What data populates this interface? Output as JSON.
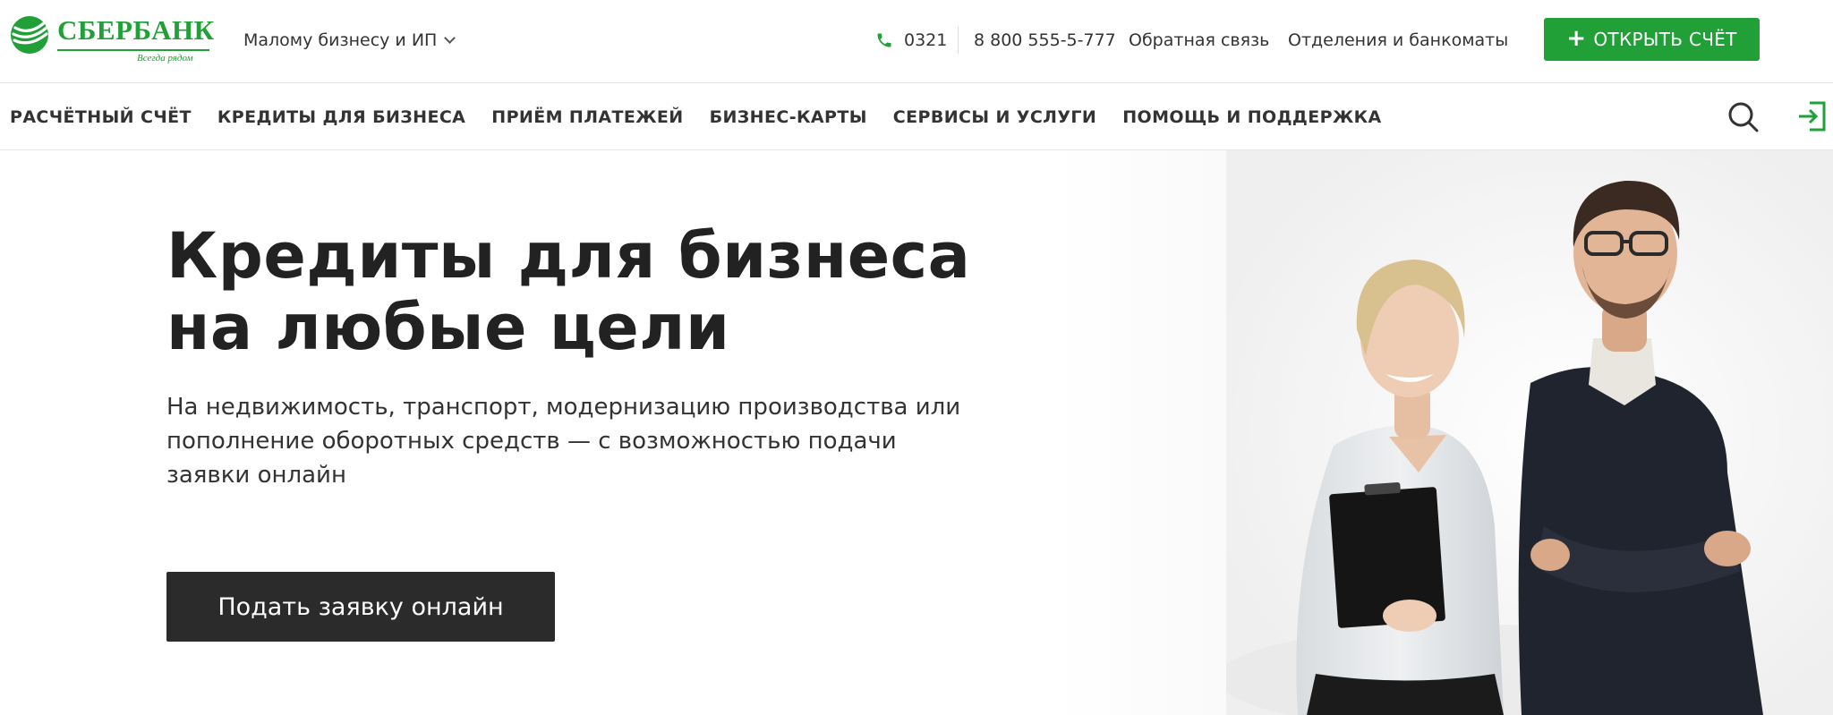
{
  "header": {
    "logo": {
      "name": "СБЕРБАНК",
      "slogan": "Всегда рядом"
    },
    "segment_label": "Малому бизнесу и ИП",
    "phone_short": "0321",
    "phone_long": "8 800 555-5-777",
    "feedback_link": "Обратная связь",
    "branches_link": "Отделения и банкоматы",
    "open_account_button": "ОТКРЫТЬ СЧЁТ"
  },
  "nav": {
    "items": [
      {
        "label": "РАСЧЁТНЫЙ СЧЁТ"
      },
      {
        "label": "КРЕДИТЫ ДЛЯ БИЗНЕСА"
      },
      {
        "label": "ПРИЁМ ПЛАТЕЖЕЙ"
      },
      {
        "label": "БИЗНЕС-КАРТЫ"
      },
      {
        "label": "СЕРВИСЫ И УСЛУГИ"
      },
      {
        "label": "ПОМОЩЬ И ПОДДЕРЖКА"
      }
    ]
  },
  "hero": {
    "title_line1": "Кредиты для бизнеса",
    "title_line2": "на любые цели",
    "subtitle": "На недвижимость, транспорт, модернизацию производства или пополнение оборотных средств — с возможностью подачи заявки онлайн",
    "cta_button": "Подать заявку онлайн"
  },
  "icons": {
    "logo": "sberbank-logo-icon",
    "chevron": "chevron-down-icon",
    "phone": "phone-icon",
    "plus": "plus-icon",
    "search": "search-icon",
    "login": "login-icon"
  },
  "colors": {
    "brand_green": "#21a038",
    "cta_dark": "#2b2b2b",
    "text_dark": "#222222"
  }
}
